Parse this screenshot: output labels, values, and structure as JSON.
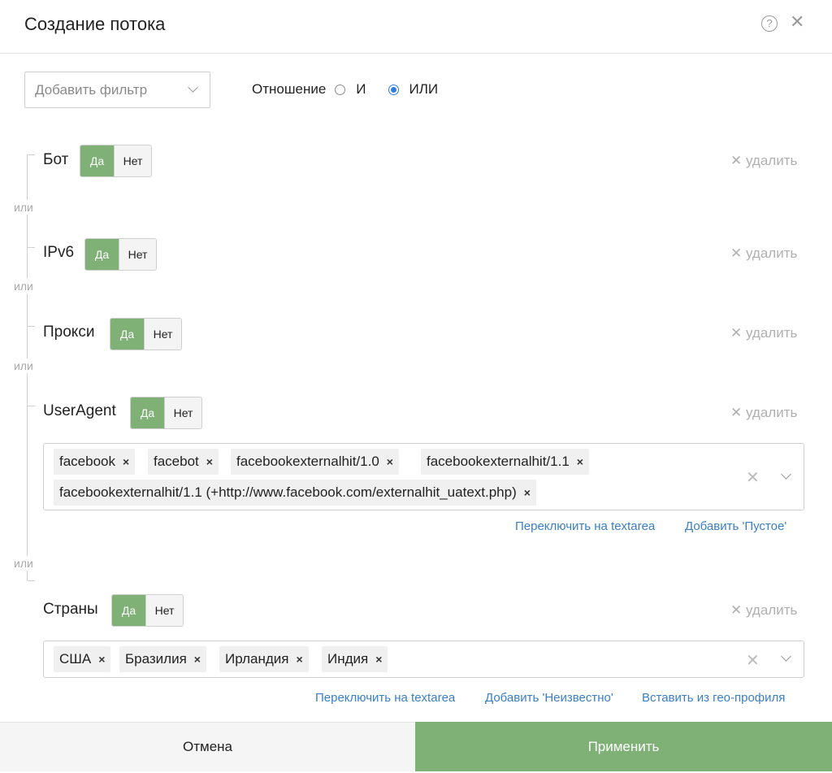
{
  "dialog": {
    "title": "Создание потока"
  },
  "filter": {
    "placeholder": "Добавить фильтр"
  },
  "relation": {
    "label": "Отношение",
    "option_and": "И",
    "option_or": "ИЛИ",
    "selected": "ИЛИ"
  },
  "or_label": "или",
  "rules": [
    {
      "label": "Бот",
      "yes": "Да",
      "no": "Нет",
      "remove": "удалить",
      "selected": "Да"
    },
    {
      "label": "IPv6",
      "yes": "Да",
      "no": "Нет",
      "remove": "удалить",
      "selected": "Да"
    },
    {
      "label": "Прокси",
      "yes": "Да",
      "no": "Нет",
      "remove": "удалить",
      "selected": "Да"
    },
    {
      "label": "UserAgent",
      "yes": "Да",
      "no": "Нет",
      "remove": "удалить",
      "selected": "Да",
      "tags": [
        "facebook",
        "facebot",
        "facebookexternalhit/1.0",
        "facebookexternalhit/1.1",
        "facebookexternalhit/1.1 (+http://www.facebook.com/externalhit_uatext.php)"
      ],
      "links": [
        "Переключить на textarea",
        "Добавить 'Пустое'"
      ]
    },
    {
      "label": "Страны",
      "yes": "Да",
      "no": "Нет",
      "remove": "удалить",
      "selected": "Да",
      "tags": [
        "США",
        "Бразилия",
        "Ирландия",
        "Индия"
      ],
      "links": [
        "Переключить на textarea",
        "Добавить 'Неизвестно'",
        "Вставить из гео-профиля"
      ]
    }
  ],
  "footer": {
    "cancel": "Отмена",
    "apply": "Применить"
  },
  "colors": {
    "accent_green": "#7fb076",
    "link_blue": "#3a7fc4",
    "radio_blue": "#2f7de1"
  },
  "icons": {
    "help": "question-circle-icon",
    "close": "close-icon",
    "chevron": "chevron-down-icon",
    "clear": "clear-icon",
    "tag_remove": "tag-remove-icon"
  }
}
